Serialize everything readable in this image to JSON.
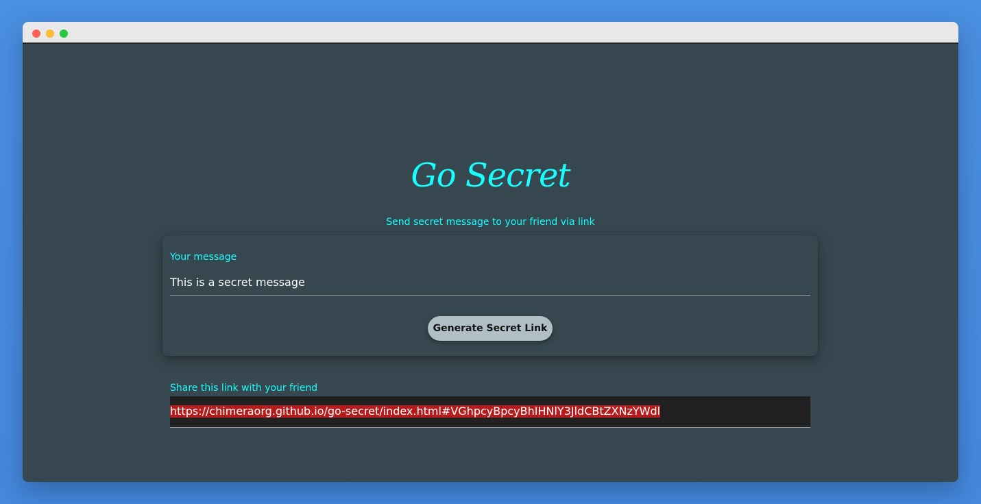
{
  "window": {
    "controls": [
      "close",
      "minimize",
      "maximize"
    ]
  },
  "app": {
    "title": "Go Secret",
    "subtitle": "Send secret message to your friend via link"
  },
  "form": {
    "message_label": "Your message",
    "message_value": "This is a secret message",
    "generate_label": "Generate Secret Link"
  },
  "share": {
    "label": "Share this link with your friend",
    "link": "https://chimeraorg.github.io/go-secret/index.html#VGhpcyBpcyBhIHNlY3JldCBtZXNzYWdl"
  },
  "colors": {
    "accent": "#18ffff",
    "background": "#37474f",
    "button": "#b0bec5",
    "link_highlight": "#b71c1c"
  }
}
